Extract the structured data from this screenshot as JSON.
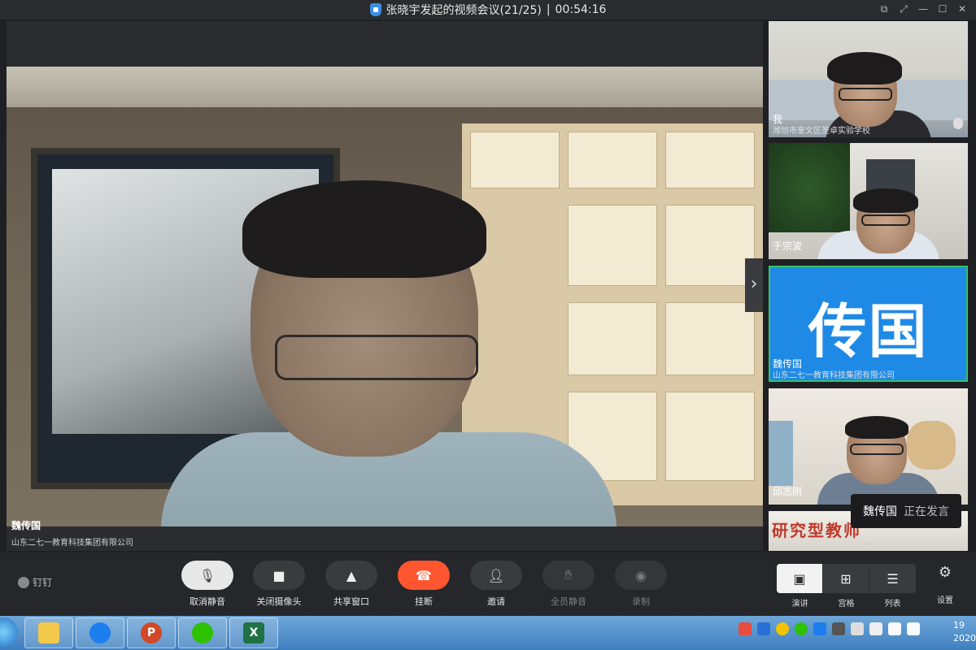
{
  "window": {
    "title": "张晓宇发起的视频会议(21/25)",
    "separator": "|",
    "duration": "00:54:16"
  },
  "main_video": {
    "name": "魏传国",
    "org": "山东二七一教育科技集团有限公司"
  },
  "participants": [
    {
      "name": "我",
      "org": "潍坊市奎文区圣卓实验学校"
    },
    {
      "name": "于宗波",
      "org": ""
    },
    {
      "name": "魏传国",
      "org": "山东二七一教育科技集团有限公司",
      "avatar_text": "传国",
      "active": true
    },
    {
      "name": "邱志刚",
      "org": ""
    },
    {
      "name": "",
      "org": "",
      "wall_text": "研究型教师"
    }
  ],
  "speaking_indicator": {
    "name": "魏传国",
    "state": "正在发言"
  },
  "brand": {
    "label": "钉钉"
  },
  "toolbar": {
    "unmute": "取消静音",
    "camera_off": "关闭摄像头",
    "share_window": "共享窗口",
    "hang_up": "挂断",
    "invite": "邀请",
    "mute_all": "全员静音",
    "record": "录制"
  },
  "layout": {
    "speaker": "演讲",
    "grid": "宫格",
    "list": "列表",
    "settings": "设置"
  },
  "taskbar": {
    "clock_time": "19",
    "clock_date": "2020"
  },
  "colors": {
    "active_tile": "#1f8ae6",
    "active_border": "#36c26b",
    "hangup": "#ff5630"
  }
}
